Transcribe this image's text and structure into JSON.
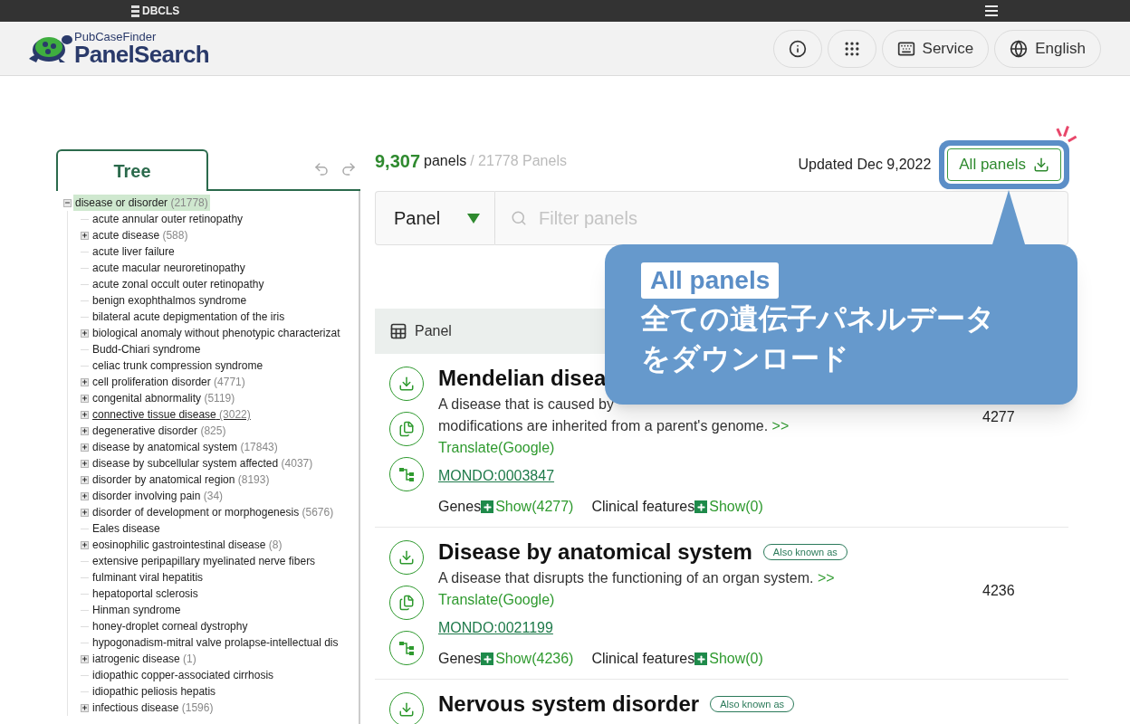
{
  "topbar": {
    "brand": "DBCLS"
  },
  "header": {
    "logo_small": "PubCaseFinder",
    "logo_large": "PanelSearch",
    "buttons": [
      {
        "kind": "info"
      },
      {
        "kind": "apps"
      },
      {
        "kind": "service",
        "label": "Service"
      },
      {
        "kind": "language",
        "label": "English"
      }
    ]
  },
  "tree": {
    "tab": "Tree",
    "items": [
      {
        "kind": "group",
        "label": "disease or disorder",
        "count": "(21778)",
        "expanded": true,
        "selected": true,
        "hovered": false,
        "children": [
          {
            "kind": "leaf",
            "label": "acute annular outer retinopathy",
            "selected": false,
            "hovered": false
          },
          {
            "kind": "group",
            "label": "acute disease",
            "count": "(588)",
            "expanded": false,
            "selected": false,
            "hovered": false
          },
          {
            "kind": "leaf",
            "label": "acute liver failure",
            "selected": false,
            "hovered": false
          },
          {
            "kind": "leaf",
            "label": "acute macular neuroretinopathy",
            "selected": false,
            "hovered": false
          },
          {
            "kind": "leaf",
            "label": "acute zonal occult outer retinopathy",
            "selected": false,
            "hovered": false
          },
          {
            "kind": "leaf",
            "label": "benign exophthalmos syndrome",
            "selected": false,
            "hovered": false
          },
          {
            "kind": "leaf",
            "label": "bilateral acute depigmentation of the iris",
            "selected": false,
            "hovered": false
          },
          {
            "kind": "group",
            "label": "biological anomaly without phenotypic characterizat",
            "expanded": false,
            "selected": false,
            "hovered": false
          },
          {
            "kind": "leaf",
            "label": "Budd-Chiari syndrome",
            "selected": false,
            "hovered": false
          },
          {
            "kind": "leaf",
            "label": "celiac trunk compression syndrome",
            "selected": false,
            "hovered": false
          },
          {
            "kind": "group",
            "label": "cell proliferation disorder",
            "count": "(4771)",
            "expanded": false,
            "selected": false,
            "hovered": false
          },
          {
            "kind": "group",
            "label": "congenital abnormality",
            "count": "(5119)",
            "expanded": false,
            "selected": false,
            "hovered": false
          },
          {
            "kind": "group",
            "label": "connective tissue disease",
            "count": "(3022)",
            "expanded": false,
            "selected": false,
            "hovered": true
          },
          {
            "kind": "group",
            "label": "degenerative disorder",
            "count": "(825)",
            "expanded": false,
            "selected": false,
            "hovered": false
          },
          {
            "kind": "group",
            "label": "disease by anatomical system",
            "count": "(17843)",
            "expanded": false,
            "selected": false,
            "hovered": false
          },
          {
            "kind": "group",
            "label": "disease by subcellular system affected",
            "count": "(4037)",
            "expanded": false,
            "selected": false,
            "hovered": false
          },
          {
            "kind": "group",
            "label": "disorder by anatomical region",
            "count": "(8193)",
            "expanded": false,
            "selected": false,
            "hovered": false
          },
          {
            "kind": "group",
            "label": "disorder involving pain",
            "count": "(34)",
            "expanded": false,
            "selected": false,
            "hovered": false
          },
          {
            "kind": "group",
            "label": "disorder of development or morphogenesis",
            "count": "(5676)",
            "expanded": false,
            "selected": false,
            "hovered": false
          },
          {
            "kind": "leaf",
            "label": "Eales disease",
            "selected": false,
            "hovered": false
          },
          {
            "kind": "group",
            "label": "eosinophilic gastrointestinal disease",
            "count": "(8)",
            "expanded": false,
            "selected": false,
            "hovered": false
          },
          {
            "kind": "leaf",
            "label": "extensive peripapillary myelinated nerve fibers",
            "selected": false,
            "hovered": false
          },
          {
            "kind": "leaf",
            "label": "fulminant viral hepatitis",
            "selected": false,
            "hovered": false
          },
          {
            "kind": "leaf",
            "label": "hepatoportal sclerosis",
            "selected": false,
            "hovered": false
          },
          {
            "kind": "leaf",
            "label": "Hinman syndrome",
            "selected": false,
            "hovered": false
          },
          {
            "kind": "leaf",
            "label": "honey-droplet corneal dystrophy",
            "selected": false,
            "hovered": false
          },
          {
            "kind": "leaf",
            "label": "hypogonadism-mitral valve prolapse-intellectual dis",
            "selected": false,
            "hovered": false
          },
          {
            "kind": "group",
            "label": "iatrogenic disease",
            "count": "(1)",
            "expanded": false,
            "selected": false,
            "hovered": false
          },
          {
            "kind": "leaf",
            "label": "idiopathic copper-associated cirrhosis",
            "selected": false,
            "hovered": false
          },
          {
            "kind": "leaf",
            "label": "idiopathic peliosis hepatis",
            "selected": false,
            "hovered": false
          },
          {
            "kind": "group",
            "label": "infectious disease",
            "count": "(1596)",
            "expanded": false,
            "selected": false,
            "hovered": false
          }
        ]
      }
    ]
  },
  "results": {
    "count": "9,307",
    "count_label": "panels",
    "total": "/ 21778 Panels",
    "updated": "Updated Dec 9,2022",
    "download_button": "All panels",
    "filter": {
      "select": "Panel",
      "placeholder": "Filter panels"
    },
    "table_header": "Panel",
    "rows": [
      {
        "title": "Mendelian disea",
        "description": [
          "A disease that is caused by",
          "modifications are inherited from a parent's genome."
        ],
        "more": ">>",
        "translate": "Translate(Google)",
        "id": "MONDO:0003847",
        "genes_label": "Genes",
        "genes_show": "Show(4277)",
        "clinical_label": "Clinical features",
        "clinical_show": "Show(0)",
        "count": "4277"
      },
      {
        "title": "Disease by anatomical system",
        "aka": "Also known as",
        "description": [
          "A disease that disrupts the functioning of an organ system."
        ],
        "more": ">>",
        "translate": "Translate(Google)",
        "id": "MONDO:0021199",
        "genes_label": "Genes",
        "genes_show": "Show(4236)",
        "clinical_label": "Clinical features",
        "clinical_show": "Show(0)",
        "count": "4236"
      },
      {
        "title": "Nervous system disorder",
        "aka": "Also known as"
      }
    ]
  },
  "callout": {
    "badge": "All panels",
    "lines": [
      "全ての遺伝子パネルデータ",
      "をダウンロード"
    ]
  }
}
